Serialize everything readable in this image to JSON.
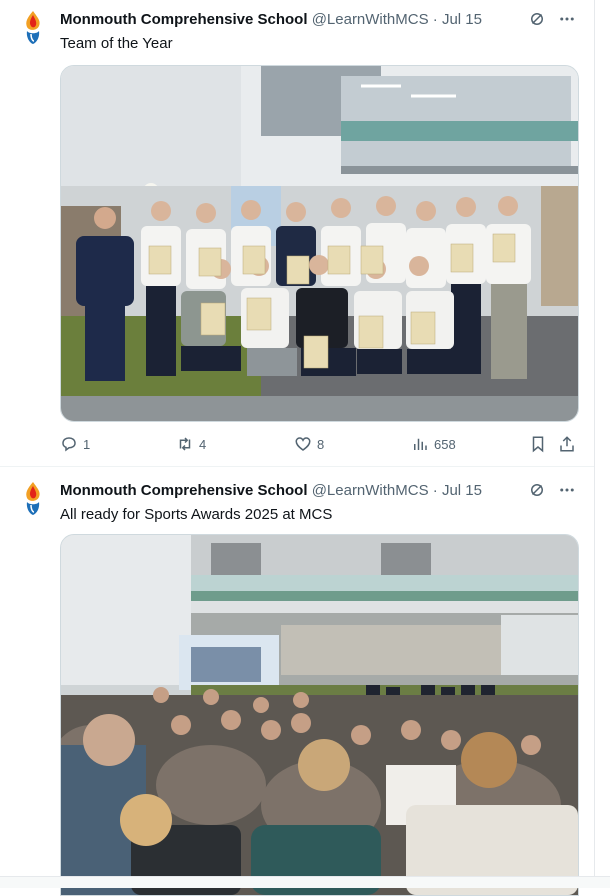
{
  "tweets": [
    {
      "author_name": "Monmouth Comprehensive School",
      "handle": "@LearnWithMCS",
      "separator": "·",
      "date": "Jul 15",
      "text": "Team of the Year",
      "photo_alt": "Group of students holding certificates",
      "stats": {
        "replies": "1",
        "retweets": "4",
        "likes": "8",
        "views": "658"
      }
    },
    {
      "author_name": "Monmouth Comprehensive School",
      "handle": "@LearnWithMCS",
      "separator": "·",
      "date": "Jul 15",
      "text": "All ready for Sports Awards 2025 at MCS",
      "photo_alt": "Audience seated in school atrium"
    }
  ],
  "icons": {
    "avatar": "flame-logo-icon",
    "grok": "grok-icon",
    "more": "more-icon",
    "reply": "reply-icon",
    "retweet": "retweet-icon",
    "like": "like-icon",
    "views": "views-icon",
    "bookmark": "bookmark-icon",
    "share": "share-icon"
  },
  "colors": {
    "text": "#0f1419",
    "secondary": "#536471",
    "border": "#eff3f4"
  }
}
